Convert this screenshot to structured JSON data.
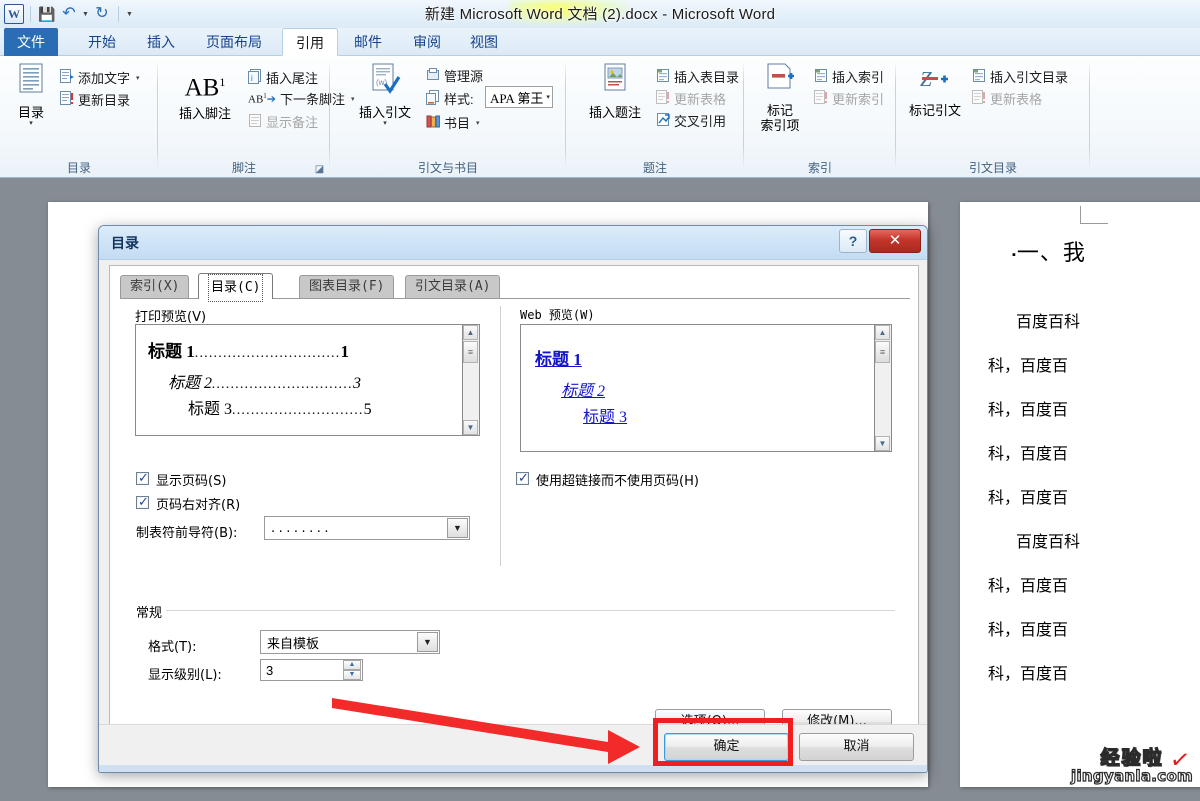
{
  "titlebar": {
    "document_title": "新建 Microsoft Word 文档 (2).docx - Microsoft Word",
    "quick_access": [
      {
        "name": "word-logo",
        "glyph": "W"
      },
      {
        "name": "save-icon",
        "glyph": "💾"
      },
      {
        "name": "undo-icon",
        "glyph": "↶"
      },
      {
        "name": "undo-dropdown-icon",
        "glyph": "▼"
      },
      {
        "name": "redo-icon",
        "glyph": "↻"
      },
      {
        "name": "customize-qat-icon",
        "glyph": "▼"
      }
    ]
  },
  "ribbon": {
    "tabs": [
      {
        "label": "文件",
        "active": false,
        "file": true
      },
      {
        "label": "开始",
        "active": false
      },
      {
        "label": "插入",
        "active": false
      },
      {
        "label": "页面布局",
        "active": false
      },
      {
        "label": "引用",
        "active": true
      },
      {
        "label": "邮件",
        "active": false
      },
      {
        "label": "审阅",
        "active": false
      },
      {
        "label": "视图",
        "active": false
      }
    ],
    "groups": [
      {
        "label": "目录",
        "big": {
          "label": "目录",
          "dropdown": "▾",
          "icon": "toc-icon"
        },
        "small": [
          {
            "label": "添加文字",
            "dropdown": true,
            "disabled": false,
            "icon": "add-text-icon"
          },
          {
            "label": "更新目录",
            "dropdown": false,
            "disabled": false,
            "icon": "update-toc-icon"
          }
        ]
      },
      {
        "label": "脚注",
        "big": {
          "label": "插入脚注",
          "icon": "insert-footnote-icon",
          "glyph": "AB"
        },
        "small": [
          {
            "label": "插入尾注",
            "dropdown": false,
            "disabled": false,
            "icon": "insert-endnote-icon"
          },
          {
            "label": "下一条脚注",
            "dropdown": true,
            "disabled": false,
            "icon": "next-footnote-icon"
          },
          {
            "label": "显示备注",
            "dropdown": false,
            "disabled": true,
            "icon": "show-notes-icon"
          }
        ],
        "dialog_launcher": true
      },
      {
        "label": "引文与书目",
        "big": {
          "label": "插入引文",
          "dropdown": "▾",
          "icon": "insert-citation-icon"
        },
        "small": [
          {
            "label": "管理源",
            "dropdown": false,
            "disabled": false,
            "icon": "manage-sources-icon"
          },
          {
            "label": "样式:",
            "dropdown": false,
            "disabled": false,
            "icon": "style-icon"
          },
          {
            "label": "书目",
            "dropdown": true,
            "disabled": false,
            "icon": "bibliography-icon"
          }
        ],
        "style_value": "APA 第王"
      },
      {
        "label": "题注",
        "big": {
          "label": "插入题注",
          "icon": "insert-caption-icon"
        },
        "small": [
          {
            "label": "插入表目录",
            "dropdown": false,
            "disabled": false,
            "icon": "insert-table-of-figures-icon"
          },
          {
            "label": "更新表格",
            "dropdown": false,
            "disabled": true,
            "icon": "update-table-icon"
          },
          {
            "label": "交叉引用",
            "dropdown": false,
            "disabled": false,
            "icon": "cross-reference-icon"
          }
        ]
      },
      {
        "label": "索引",
        "big": {
          "label": "标记\n索引项",
          "line1": "标记",
          "line2": "索引项",
          "icon": "mark-entry-icon"
        },
        "small": [
          {
            "label": "插入索引",
            "dropdown": false,
            "disabled": false,
            "icon": "insert-index-icon"
          },
          {
            "label": "更新索引",
            "dropdown": false,
            "disabled": true,
            "icon": "update-index-icon"
          }
        ]
      },
      {
        "label": "引文目录",
        "big": {
          "label": "标记引文",
          "icon": "mark-citation-icon"
        },
        "small": [
          {
            "label": "插入引文目录",
            "dropdown": false,
            "disabled": false,
            "icon": "insert-table-of-authorities-icon"
          },
          {
            "label": "更新表格",
            "dropdown": false,
            "disabled": true,
            "icon": "update-table-icon"
          }
        ]
      }
    ]
  },
  "dialog": {
    "title": "目录",
    "help_glyph": "?",
    "close_glyph": "✕",
    "tabs": [
      {
        "label": "索引(X)",
        "active": false
      },
      {
        "label": "目录(C)",
        "active": true
      },
      {
        "label": "图表目录(F)",
        "active": false
      },
      {
        "label": "引文目录(A)",
        "active": false
      }
    ],
    "print_preview": {
      "label": "打印预览(V)",
      "entries": [
        {
          "text": "标题  1",
          "page": "1",
          "level": 1
        },
        {
          "text": "标题 2",
          "page": "3",
          "level": 2
        },
        {
          "text": "标题  3",
          "page": "5",
          "level": 3
        }
      ]
    },
    "web_preview": {
      "label": "Web 预览(W)",
      "entries": [
        {
          "text": "标题  1",
          "level": 1
        },
        {
          "text": "标题 2",
          "level": 2
        },
        {
          "text": "标题  3",
          "level": 3
        }
      ]
    },
    "checkboxes": [
      {
        "label": "显示页码(S)",
        "checked": true,
        "name": "show-page-numbers"
      },
      {
        "label": "页码右对齐(R)",
        "checked": true,
        "name": "right-align-page-numbers"
      },
      {
        "label": "使用超链接而不使用页码(H)",
        "checked": true,
        "name": "use-hyperlinks"
      }
    ],
    "tab_leader": {
      "label": "制表符前导符(B):",
      "value": "........"
    },
    "general": {
      "label": "常规",
      "format": {
        "label": "格式(T):",
        "value": "来自模板"
      },
      "show_levels": {
        "label": "显示级别(L):",
        "value": "3"
      }
    },
    "buttons": [
      {
        "label": "选项(O)...",
        "name": "options-button",
        "default": false
      },
      {
        "label": "修改(M)...",
        "name": "modify-button",
        "default": false
      },
      {
        "label": "确定",
        "name": "ok-button",
        "default": true
      },
      {
        "label": "取消",
        "name": "cancel-button",
        "default": false
      }
    ]
  },
  "document": {
    "heading": "一、我",
    "bullet": "▪",
    "paragraphs": [
      "百度百科",
      "科，百度百",
      "科，百度百",
      "科，百度百",
      "科，百度百",
      "百度百科",
      "科，百度百",
      "科，百度百",
      "科，百度百"
    ]
  },
  "watermark": {
    "line1": "经验啦",
    "line2": "jingyanla.com",
    "check": "✓"
  },
  "colors": {
    "accent": "#2a6db5",
    "annotation_red": "#f01e1e",
    "link_blue": "#1414c8",
    "close_red": "#c4352b"
  }
}
